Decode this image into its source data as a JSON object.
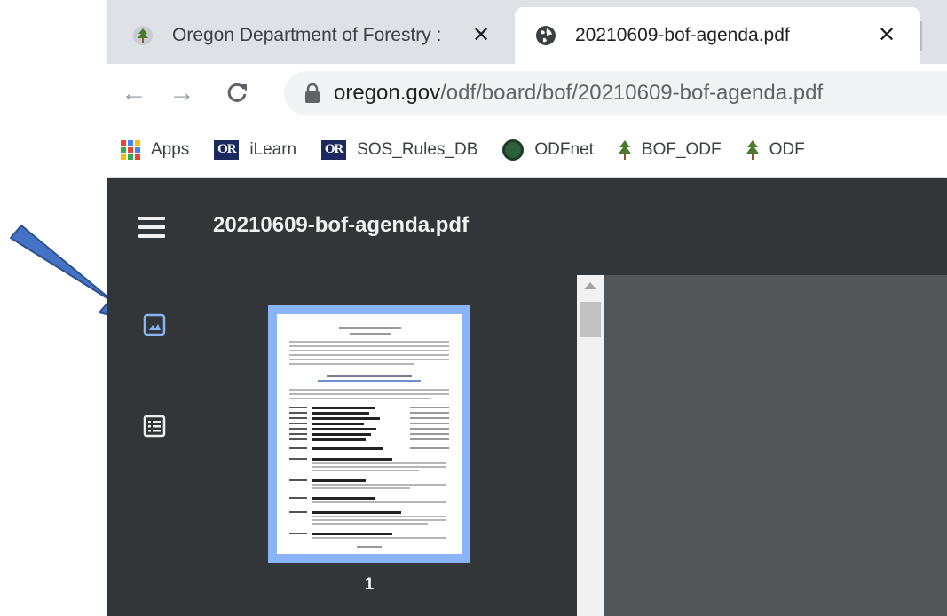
{
  "tabs": [
    {
      "title": "Oregon Department of Forestry :",
      "favicon": "tree-icon",
      "active": false,
      "close_label": "✕"
    },
    {
      "title": "20210609-bof-agenda.pdf",
      "favicon": "globe-icon",
      "active": true,
      "close_label": "✕"
    }
  ],
  "toolbar": {
    "back_label": "←",
    "forward_label": "→",
    "reload_label": "C",
    "url_host": "oregon.gov",
    "url_path": "/odf/board/bof/20210609-bof-agenda.pdf"
  },
  "bookmarks": [
    {
      "label": "Apps",
      "icon": "apps-grid-icon"
    },
    {
      "label": "iLearn",
      "icon": "or-icon",
      "badge": "OR"
    },
    {
      "label": "SOS_Rules_DB",
      "icon": "or-icon",
      "badge": "OR"
    },
    {
      "label": "ODFnet",
      "icon": "odfnet-icon"
    },
    {
      "label": "BOF_ODF",
      "icon": "tree-icon"
    },
    {
      "label": "ODF",
      "icon": "tree-icon"
    }
  ],
  "viewer": {
    "title": "20210609-bof-agenda.pdf",
    "page_number": "1",
    "sidebar_buttons": [
      {
        "name": "thumbnails-icon"
      },
      {
        "name": "document-outline-icon"
      }
    ]
  },
  "colors": {
    "tabstrip": "#dee1e6",
    "viewer_header": "#323639",
    "viewer_bg": "#525659",
    "thumbnail_highlight": "#8ab4f8",
    "arrow": "#4472c4"
  }
}
